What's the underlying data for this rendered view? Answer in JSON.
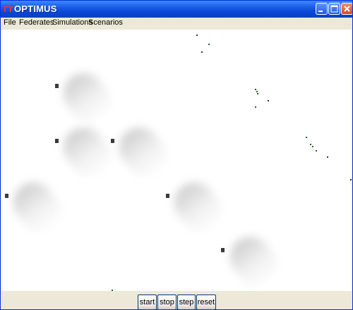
{
  "window": {
    "title": "OPTIMUS",
    "icons": [
      "app-logo-icon",
      "minimize-icon",
      "maximize-icon",
      "close-icon"
    ]
  },
  "menu": {
    "items": [
      "File",
      "Federates",
      "Simulations",
      "Scenarios"
    ]
  },
  "controls": {
    "start_label": "start",
    "stop_label": "stop",
    "step_label": "step",
    "reset_label": "reset"
  },
  "colors": {
    "titlebar": "#0a48d6",
    "canvas": "#ffffff",
    "entity_dot": "#1b6b1b",
    "object_marker": "#3a3a3a",
    "window_face": "#ece9d8"
  }
}
